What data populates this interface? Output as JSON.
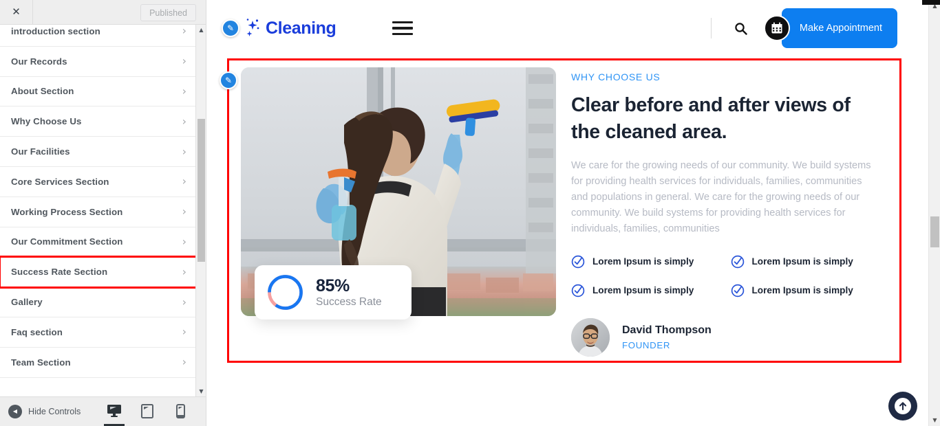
{
  "editor": {
    "topbar": {
      "close_icon": "close-icon",
      "publish_label": "Published"
    },
    "sections": [
      {
        "label": "introduction section",
        "chevron": "chevron-right-icon",
        "highlighted": false
      },
      {
        "label": "Our Records",
        "chevron": "chevron-right-icon",
        "highlighted": false
      },
      {
        "label": "About Section",
        "chevron": "chevron-right-icon",
        "highlighted": false
      },
      {
        "label": "Why Choose Us",
        "chevron": "chevron-right-icon",
        "highlighted": false
      },
      {
        "label": "Our Facilities",
        "chevron": "chevron-right-icon",
        "highlighted": false
      },
      {
        "label": "Core Services Section",
        "chevron": "chevron-right-icon",
        "highlighted": false
      },
      {
        "label": "Working Process Section",
        "chevron": "chevron-right-icon",
        "highlighted": false
      },
      {
        "label": "Our Commitment Section",
        "chevron": "chevron-right-icon",
        "highlighted": false
      },
      {
        "label": "Success Rate Section",
        "chevron": "chevron-right-icon",
        "highlighted": true
      },
      {
        "label": "Gallery",
        "chevron": "chevron-right-icon",
        "highlighted": false
      },
      {
        "label": "Faq section",
        "chevron": "chevron-right-icon",
        "highlighted": false
      },
      {
        "label": "Team Section",
        "chevron": "chevron-right-icon",
        "highlighted": false
      }
    ],
    "footer": {
      "hide_controls_label": "Hide Controls",
      "devices": [
        {
          "name": "desktop-preview",
          "icon": "desktop-icon",
          "active": true
        },
        {
          "name": "tablet-preview",
          "icon": "tablet-icon",
          "active": false
        },
        {
          "name": "mobile-preview",
          "icon": "mobile-icon",
          "active": false
        }
      ]
    },
    "scrollbar": {
      "up_arrow": "▲",
      "down_arrow": "▼"
    }
  },
  "site": {
    "header": {
      "logo_text": "Cleaning",
      "logo_edit_icon": "pencil-edit-icon",
      "logo_sparkle_icon": "sparkle-icon",
      "menu_icon": "hamburger-menu-icon",
      "search_icon": "search-icon",
      "appointment_icon": "calendar-icon",
      "appointment_label": "Make Appointment"
    },
    "section": {
      "edit_badge_icon": "pencil-edit-icon",
      "eyebrow": "WHY CHOOSE US",
      "headline": "Clear before and after views of the cleaned area.",
      "paragraph": "We care for the growing needs of our community. We build systems for providing health services for individuals, families, communities and populations in general. We care for the growing needs of our community. We build systems for providing health services for individuals, families, communities",
      "features": [
        {
          "label": "Lorem Ipsum is simply",
          "icon": "check-circle-icon"
        },
        {
          "label": "Lorem Ipsum is simply",
          "icon": "check-circle-icon"
        },
        {
          "label": "Lorem Ipsum is simply",
          "icon": "check-circle-icon"
        },
        {
          "label": "Lorem Ipsum is simply",
          "icon": "check-circle-icon"
        }
      ],
      "founder": {
        "avatar_icon": "avatar",
        "name": "David Thompson",
        "role": "FOUNDER"
      },
      "stat_card": {
        "value": "85%",
        "label": "Success Rate",
        "percent": 85
      },
      "photo_alt": "woman-cleaning-window"
    },
    "scroll_top_icon": "arrow-up-icon"
  },
  "colors": {
    "brand_blue": "#1a3ddb",
    "accent_blue": "#0d7ef0",
    "link_blue": "#2f94f5",
    "donut_fill": "#1877f2",
    "donut_rest": "#f6a0a0",
    "selection_red": "#ff0000",
    "dark_navy": "#1f2a44",
    "heading": "#1b2433",
    "muted_text": "#b6bac4",
    "sidebar_text": "#50575e"
  }
}
